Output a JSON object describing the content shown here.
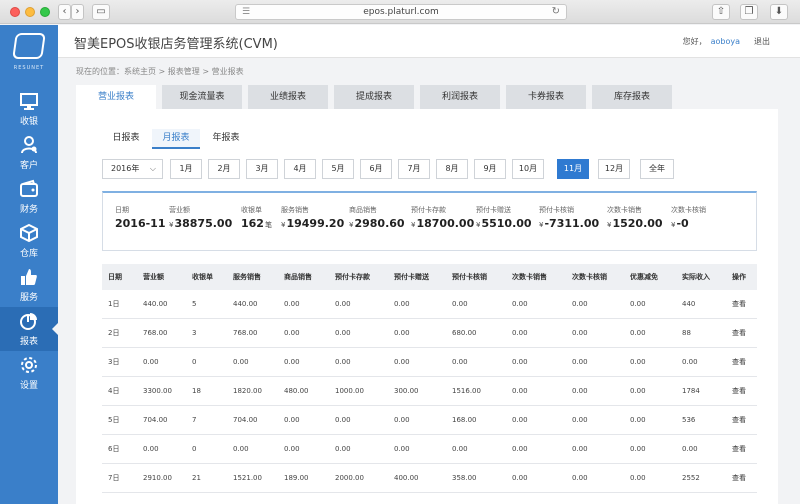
{
  "browser": {
    "url": "epos.platurl.com"
  },
  "sidebar": {
    "brand": "RESUNET",
    "items": [
      {
        "label": "收银",
        "icon": "monitor-icon"
      },
      {
        "label": "客户",
        "icon": "customer-icon"
      },
      {
        "label": "财务",
        "icon": "wallet-icon"
      },
      {
        "label": "仓库",
        "icon": "box-icon"
      },
      {
        "label": "服务",
        "icon": "thumbs-up-icon"
      },
      {
        "label": "报表",
        "icon": "pie-chart-icon",
        "active": true
      },
      {
        "label": "设置",
        "icon": "gear-icon"
      }
    ]
  },
  "header": {
    "title": "智美EPOS收银店务管理系统(CVM)",
    "greeting": "您好，",
    "username": "aoboya",
    "logout": "退出"
  },
  "breadcrumb": "现在的位置：系统主页 > 报表管理 > 营业报表",
  "tabs": [
    "营业报表",
    "现金流量表",
    "业绩报表",
    "提成报表",
    "利润报表",
    "卡券报表",
    "库存报表"
  ],
  "period_tabs": [
    "日报表",
    "月报表",
    "年报表"
  ],
  "filter": {
    "year": "2016年",
    "months": [
      "1月",
      "2月",
      "3月",
      "4月",
      "5月",
      "6月",
      "7月",
      "8月",
      "9月",
      "10月",
      "11月",
      "12月"
    ],
    "selected_month": "11月",
    "all_year": "全年"
  },
  "summary": {
    "date": {
      "label": "日期",
      "value": "2016-11"
    },
    "revenue": {
      "label": "营业额",
      "value": "38875.00"
    },
    "receipts": {
      "label": "收银单",
      "value": "162",
      "unit": "笔"
    },
    "service_sales": {
      "label": "服务销售",
      "value": "19499.20"
    },
    "product_sales": {
      "label": "商品销售",
      "value": "2980.60"
    },
    "prepaid_deposit": {
      "label": "预付卡存款",
      "value": "18700.00"
    },
    "prepaid_gift": {
      "label": "预付卡赠送",
      "value": "5510.00"
    },
    "prepaid_redeem": {
      "label": "预付卡核销",
      "value": "-7311.00"
    },
    "count_card_sales": {
      "label": "次数卡销售",
      "value": "1520.00"
    },
    "count_card_redeem": {
      "label": "次数卡核销",
      "value": "-0"
    },
    "currency": "¥"
  },
  "table": {
    "columns": [
      "日期",
      "营业额",
      "收银单",
      "服务销售",
      "商品销售",
      "预付卡存款",
      "预付卡赠送",
      "预付卡核销",
      "次数卡销售",
      "次数卡核销",
      "优惠减免",
      "实际收入",
      "操作"
    ],
    "action_label": "查看",
    "rows": [
      [
        "1日",
        "440.00",
        "5",
        "440.00",
        "0.00",
        "0.00",
        "0.00",
        "0.00",
        "0.00",
        "0.00",
        "0.00",
        "440"
      ],
      [
        "2日",
        "768.00",
        "3",
        "768.00",
        "0.00",
        "0.00",
        "0.00",
        "680.00",
        "0.00",
        "0.00",
        "0.00",
        "88"
      ],
      [
        "3日",
        "0.00",
        "0",
        "0.00",
        "0.00",
        "0.00",
        "0.00",
        "0.00",
        "0.00",
        "0.00",
        "0.00",
        "0.00"
      ],
      [
        "4日",
        "3300.00",
        "18",
        "1820.00",
        "480.00",
        "1000.00",
        "300.00",
        "1516.00",
        "0.00",
        "0.00",
        "0.00",
        "1784"
      ],
      [
        "5日",
        "704.00",
        "7",
        "704.00",
        "0.00",
        "0.00",
        "0.00",
        "168.00",
        "0.00",
        "0.00",
        "0.00",
        "536"
      ],
      [
        "6日",
        "0.00",
        "0",
        "0.00",
        "0.00",
        "0.00",
        "0.00",
        "0.00",
        "0.00",
        "0.00",
        "0.00",
        "0.00"
      ],
      [
        "7日",
        "2910.00",
        "21",
        "1521.00",
        "189.00",
        "2000.00",
        "400.00",
        "358.00",
        "0.00",
        "0.00",
        "0.00",
        "2552"
      ]
    ]
  },
  "colors": {
    "sidebar": "#3a7fc9",
    "accent": "#2f7ad1"
  }
}
